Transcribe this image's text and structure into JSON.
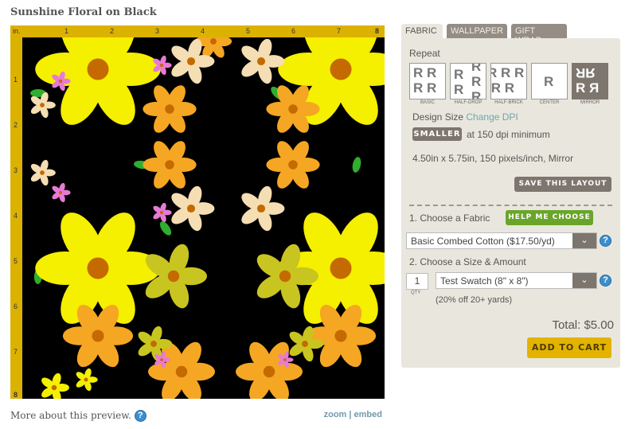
{
  "title": "Sunshine Floral on Black",
  "ruler": {
    "unit": "in.",
    "top": [
      "1",
      "2",
      "3",
      "4",
      "5",
      "6",
      "7",
      "8"
    ],
    "left": [
      "1",
      "2",
      "3",
      "4",
      "5",
      "6",
      "7",
      "8"
    ]
  },
  "footer": {
    "more": "More about this preview.",
    "zoom": "zoom",
    "sep": "|",
    "embed": "embed"
  },
  "tabs": [
    {
      "label": "FABRIC",
      "active": true
    },
    {
      "label": "WALLPAPER"
    },
    {
      "label": "GIFT WRAP"
    }
  ],
  "repeat": {
    "label": "Repeat",
    "options": [
      {
        "label": "BASIC"
      },
      {
        "label": "HALF-DROP"
      },
      {
        "label": "HALF-BRICK"
      },
      {
        "label": "CENTER"
      },
      {
        "label": "MIRROR",
        "selected": true
      }
    ]
  },
  "design_size": {
    "label": "Design Size",
    "link": "Change DPI",
    "smaller": "SMALLER",
    "min_text": "at 150 dpi minimum",
    "info": "4.50in x 5.75in, 150 pixels/inch, Mirror",
    "save": "SAVE THIS LAYOUT"
  },
  "fabric": {
    "label": "1. Choose a Fabric",
    "help": "HELP ME CHOOSE",
    "value": "Basic Combed Cotton ($17.50/yd)"
  },
  "size": {
    "label": "2. Choose a Size & Amount",
    "qty": "1",
    "qty_label": "QTY",
    "value": "Test Swatch (8\" x 8\")",
    "discount": "(20% off 20+ yards)"
  },
  "total": "Total: $5.00",
  "add_to_cart": "ADD TO CART",
  "colors": {
    "ruler": "#dcb200",
    "help_green": "#6aa52a",
    "cart": "#e3b300",
    "button_gray": "#7d766e",
    "panel": "#e9e7dd"
  }
}
